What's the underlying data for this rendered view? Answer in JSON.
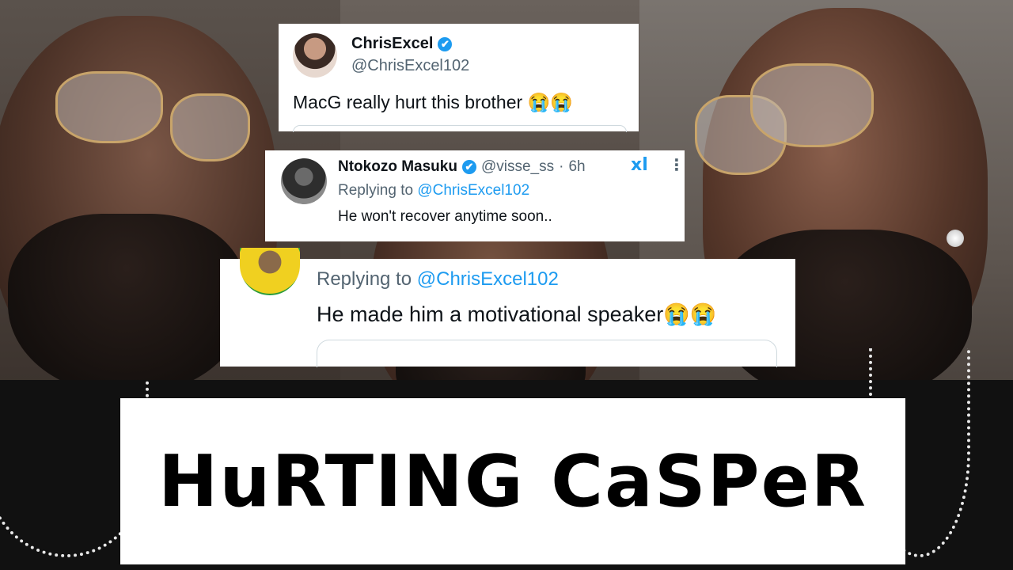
{
  "tweets": [
    {
      "name": "ChrisExcel",
      "handle": "@ChrisExcel102",
      "text": "MacG really hurt this brother 😭😭"
    },
    {
      "name": "Ntokozo Masuku",
      "handle": "@visse_ss",
      "separator": "·",
      "time": "6h",
      "replying_prefix": "Replying to ",
      "replying_to": "@ChrisExcel102",
      "text": "He won't recover anytime soon.."
    },
    {
      "replying_prefix": "Replying to ",
      "replying_to": "@ChrisExcel102",
      "text": "He made him a motivational speaker😭😭"
    }
  ],
  "icons": {
    "verified": "✔",
    "app": "xl",
    "more": "⋮"
  },
  "title": "HuRTING CaSPeR",
  "colors": {
    "link": "#1d9bf0",
    "muted": "#536471",
    "frame": "#c8a46a"
  }
}
